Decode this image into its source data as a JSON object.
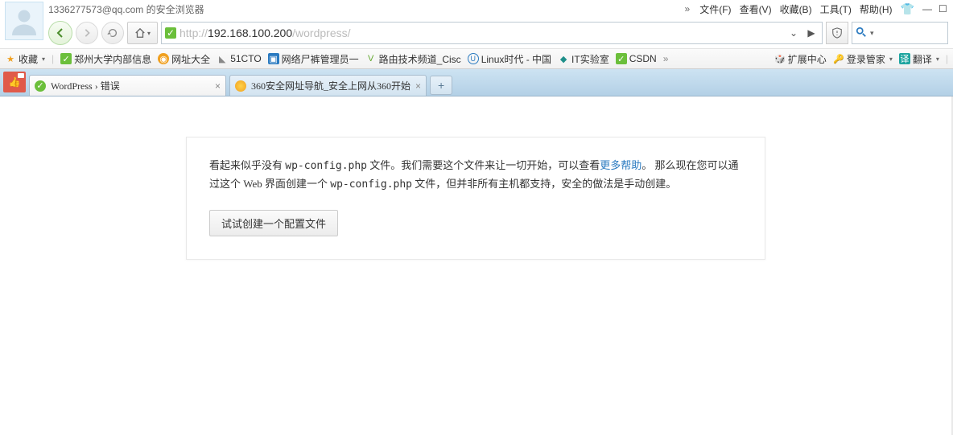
{
  "titlebar": {
    "left": "1336277573@qq.com 的安全浏览器",
    "menus": [
      "文件(F)",
      "查看(V)",
      "收藏(B)",
      "工具(T)",
      "帮助(H)"
    ]
  },
  "url": {
    "scheme": "http://",
    "host": "192.168.100.200",
    "path": "/wordpress/"
  },
  "bookmarks_left_label": "收藏",
  "bookmarks_left": [
    {
      "icon": "news-icon",
      "label": "郑州大学内部信息"
    },
    {
      "icon": "compass-icon",
      "label": "网址大全"
    },
    {
      "icon": "tag-icon",
      "label": "51CTO"
    },
    {
      "icon": "book-icon",
      "label": "网络尸裤管理员一"
    },
    {
      "icon": "v-icon",
      "label": "路由技术频道_Cisc"
    },
    {
      "icon": "u-icon",
      "label": "Linux时代 - 中国"
    },
    {
      "icon": "lab-icon",
      "label": "IT实验室"
    },
    {
      "icon": "csdn-icon",
      "label": "CSDN"
    }
  ],
  "bookmarks_right": [
    {
      "icon": "cube-icon",
      "label": "扩展中心"
    },
    {
      "icon": "key-icon",
      "label": "登录管家"
    },
    {
      "icon": "translate-icon",
      "label": "翻译"
    }
  ],
  "tabs": [
    {
      "icon": "wp-icon",
      "label": "WordPress › 错误"
    },
    {
      "icon": "360-icon",
      "label": "360安全网址导航_安全上网从360开始"
    }
  ],
  "page": {
    "p1a": "看起来似乎没有 ",
    "p1code": "wp-config.php",
    "p1b": " 文件。我们需要这个文件来让一切开始，可以查看",
    "p1link": "更多帮助",
    "p1c": "。 那么现在您可以通过这个 Web 界面创建一个 ",
    "p1code2": "wp-config.php",
    "p1d": " 文件，但并非所有主机都支持，安全的做法是手动创建。",
    "button": "试试创建一个配置文件"
  }
}
